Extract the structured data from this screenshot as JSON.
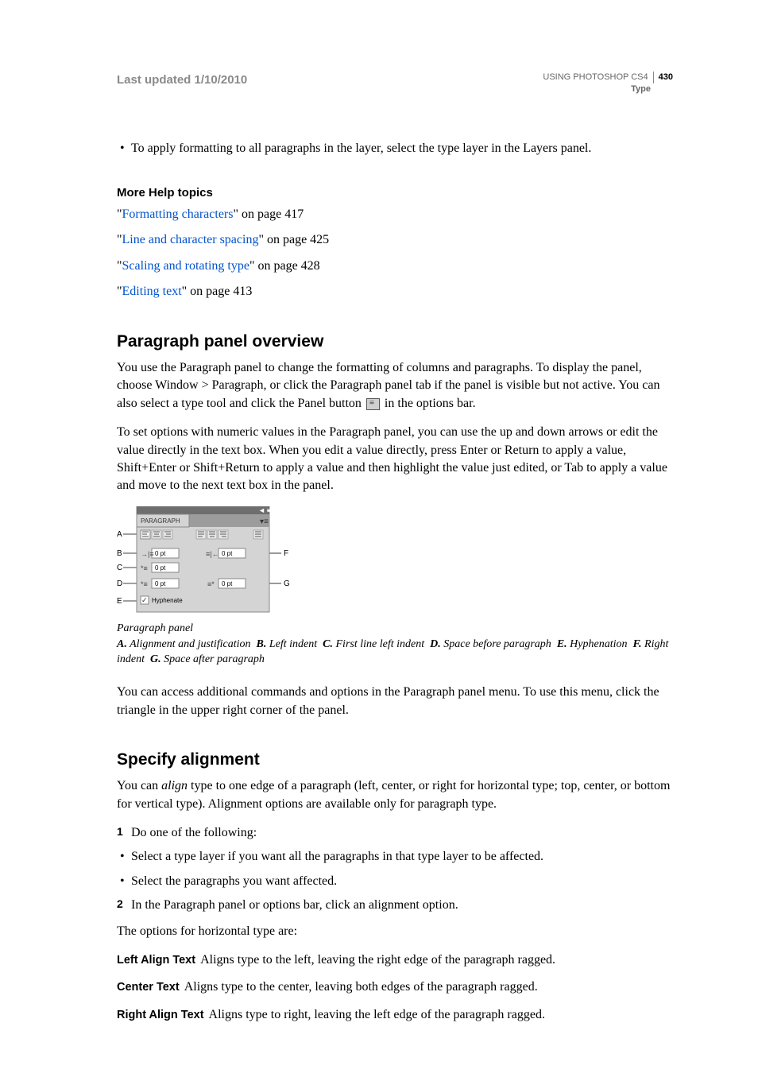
{
  "header": {
    "last_updated": "Last updated 1/10/2010",
    "doc_title": "USING PHOTOSHOP CS4",
    "page_number": "430",
    "section": "Type"
  },
  "intro_bullet": "To apply formatting to all paragraphs in the layer, select the type layer in the Layers panel.",
  "more_help": {
    "heading": "More Help topics",
    "items": [
      {
        "link": "Formatting characters",
        "suffix": " on page 417"
      },
      {
        "link": "Line and character spacing",
        "suffix": " on page 425"
      },
      {
        "link": "Scaling and rotating type",
        "suffix": " on page 428"
      },
      {
        "link": "Editing text",
        "suffix": " on page 413"
      }
    ]
  },
  "section1": {
    "title": "Paragraph panel overview",
    "p1_a": "You use the Paragraph panel to change the formatting of columns and paragraphs. To display the panel, choose Window > Paragraph, or click the Paragraph panel tab if the panel is visible but not active. You can also select a type tool and click the Panel button ",
    "p1_b": " in the options bar.",
    "p2": "To set options with numeric values in the Paragraph panel, you can use the up and down arrows or edit the value directly in the text box. When you edit a value directly, press Enter or Return to apply a value, Shift+Enter or Shift+Return to apply a value and then highlight the value just edited, or Tab to apply a value and move to the next text box in the panel.",
    "figure": {
      "panel_tab": "PARAGRAPH",
      "hyphenate": "Hyphenate",
      "value": "0 pt",
      "labels": {
        "A": "A",
        "B": "B",
        "C": "C",
        "D": "D",
        "E": "E",
        "F": "F",
        "G": "G"
      },
      "caption": "Paragraph panel",
      "legend_items": [
        {
          "key": "A.",
          "text": "Alignment and justification"
        },
        {
          "key": "B.",
          "text": "Left indent"
        },
        {
          "key": "C.",
          "text": "First line left indent"
        },
        {
          "key": "D.",
          "text": "Space before paragraph"
        },
        {
          "key": "E.",
          "text": "Hyphenation"
        },
        {
          "key": "F.",
          "text": "Right indent"
        },
        {
          "key": "G.",
          "text": "Space after paragraph"
        }
      ]
    },
    "p3": "You can access additional commands and options in the Paragraph panel menu. To use this menu, click the triangle in the upper right corner of the panel."
  },
  "section2": {
    "title": "Specify alignment",
    "p1_a": "You can ",
    "p1_i": "align",
    "p1_b": " type to one edge of a paragraph (left, center, or right for horizontal type; top, center, or bottom for vertical type). Alignment options are available only for paragraph type.",
    "steps": {
      "s1": "Do one of the following:",
      "s1a": "Select a type layer if you want all the paragraphs in that type layer to be affected.",
      "s1b": "Select the paragraphs you want affected.",
      "s2": "In the Paragraph panel or options bar, click an alignment option."
    },
    "p2": "The options for horizontal type are:",
    "defs": [
      {
        "term": "Left Align Text",
        "desc": "Aligns type to the left, leaving the right edge of the paragraph ragged."
      },
      {
        "term": "Center Text",
        "desc": "Aligns type to the center, leaving both edges of the paragraph ragged."
      },
      {
        "term": "Right Align Text",
        "desc": "Aligns type to right, leaving the left edge of the paragraph ragged."
      }
    ]
  }
}
